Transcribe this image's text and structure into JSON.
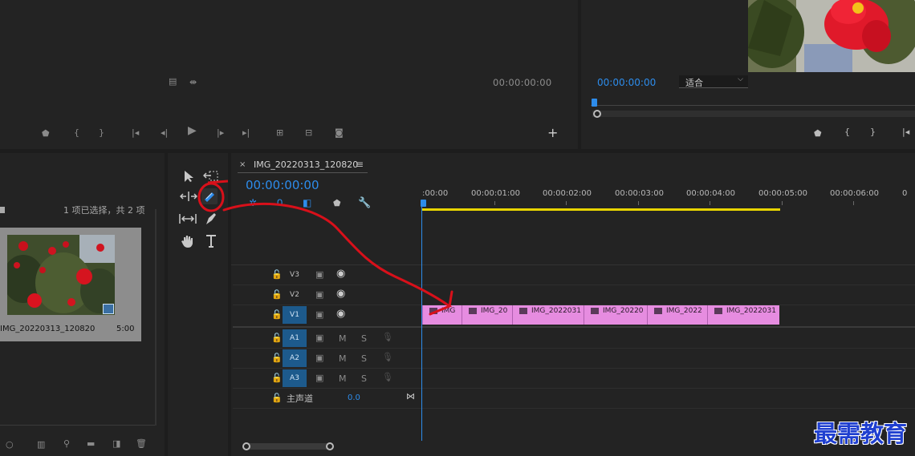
{
  "source_monitor": {
    "timecode": "00:00:00:00"
  },
  "program_monitor": {
    "timecode": "00:00:00:00",
    "fit_label": "适合"
  },
  "project_panel": {
    "selection_status": "1 项已选择，共 2 项",
    "clip_name": "IMG_20220313_120820",
    "clip_duration": "5:00"
  },
  "timeline": {
    "sequence_tab": "IMG_20220313_120820",
    "timecode": "00:00:00:00",
    "ruler_labels": [
      ":00:00",
      "00:00:01:00",
      "00:00:02:00",
      "00:00:03:00",
      "00:00:04:00",
      "00:00:05:00",
      "00:00:06:00",
      "0"
    ],
    "video_tracks": [
      {
        "label": "V3",
        "toggle": "",
        "active": false
      },
      {
        "label": "V2",
        "toggle": "",
        "active": false
      },
      {
        "label": "V1",
        "toggle": "V1",
        "active": true
      }
    ],
    "audio_tracks": [
      {
        "label": "A1",
        "toggle": "A1",
        "m": "M",
        "s": "S"
      },
      {
        "label": "A2",
        "toggle": "A2",
        "m": "M",
        "s": "S"
      },
      {
        "label": "A3",
        "toggle": "A3",
        "m": "M",
        "s": "S"
      }
    ],
    "master": {
      "label": "主声道",
      "value": "0.0"
    },
    "clips": [
      "IMG",
      "IMG_20",
      "IMG_2022031",
      "IMG_20220",
      "IMG_2022",
      "IMG_2022031"
    ]
  },
  "watermark": "最需教育",
  "colors": {
    "accent_blue": "#2d8ceb",
    "clip_pink": "#e68ce0",
    "work_area_yellow": "#e8d400",
    "annotation_red": "#d8101a"
  }
}
